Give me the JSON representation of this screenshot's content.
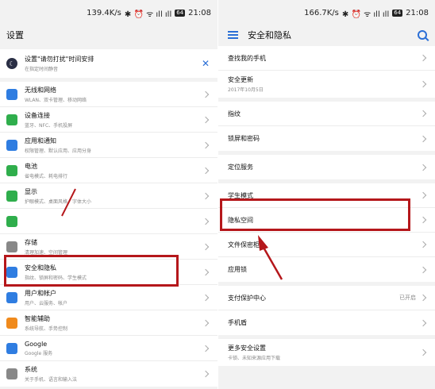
{
  "left": {
    "status": {
      "speed": "139.4K/s",
      "battery": "64",
      "time": "21:08"
    },
    "title": "设置",
    "notice": {
      "label": "设置\"请勿打扰\"时间安排",
      "sub": "在指定时间静音"
    },
    "items": [
      {
        "label": "无线和网络",
        "sub": "WLAN、双卡管理、移动网络",
        "icon": "wifi-icon",
        "color": "#2f7de1"
      },
      {
        "label": "设备连接",
        "sub": "蓝牙、NFC、手机投屏",
        "icon": "device-connect-icon",
        "color": "#2fae4c"
      },
      {
        "label": "应用和通知",
        "sub": "权限管理、默认应用、应用分身",
        "icon": "apps-icon",
        "color": "#2f7de1"
      },
      {
        "label": "电池",
        "sub": "省电模式、耗电排行",
        "icon": "battery-icon",
        "color": "#2fae4c"
      },
      {
        "label": "显示",
        "sub": "护眼模式、桌面风格、字体大小",
        "icon": "display-icon",
        "color": "#2fae4c"
      },
      {
        "label": "",
        "sub": "",
        "icon": "sound-icon",
        "color": "#2fae4c"
      },
      {
        "label": "存储",
        "sub": "清理加速、空间管理",
        "icon": "storage-icon",
        "color": "#888888"
      },
      {
        "label": "安全和隐私",
        "sub": "指纹、锁屏和密码、学生模式",
        "icon": "shield-icon",
        "color": "#2f7de1"
      },
      {
        "label": "用户和帐户",
        "sub": "用户、云服务、帐户",
        "icon": "user-icon",
        "color": "#2f7de1"
      },
      {
        "label": "智能辅助",
        "sub": "系统导航、手势控制",
        "icon": "hand-icon",
        "color": "#f08a1c"
      },
      {
        "label": "Google",
        "sub": "Google 服务",
        "icon": "google-icon",
        "color": "#2f7de1"
      },
      {
        "label": "系统",
        "sub": "关于手机、语言和输入法",
        "icon": "system-icon",
        "color": "#888888"
      }
    ]
  },
  "right": {
    "status": {
      "speed": "166.7K/s",
      "battery": "64",
      "time": "21:08"
    },
    "title": "安全和隐私",
    "items": [
      {
        "label": "查找我的手机",
        "sub": ""
      },
      {
        "label": "安全更新",
        "sub": "2017年10月5日"
      },
      {
        "label": "指纹",
        "sub": ""
      },
      {
        "label": "锁屏和密码",
        "sub": ""
      },
      {
        "label": "定位服务",
        "sub": ""
      },
      {
        "label": "学生模式",
        "sub": ""
      },
      {
        "label": "隐私空间",
        "sub": ""
      },
      {
        "label": "文件保密柜",
        "sub": ""
      },
      {
        "label": "应用锁",
        "sub": ""
      },
      {
        "label": "支付保护中心",
        "sub": "",
        "value": "已开启"
      },
      {
        "label": "手机盾",
        "sub": ""
      },
      {
        "label": "更多安全设置",
        "sub": "卡锁、未知来源应用下载"
      }
    ]
  },
  "accent": "#2b6fd6",
  "highlight": "#b5171b"
}
